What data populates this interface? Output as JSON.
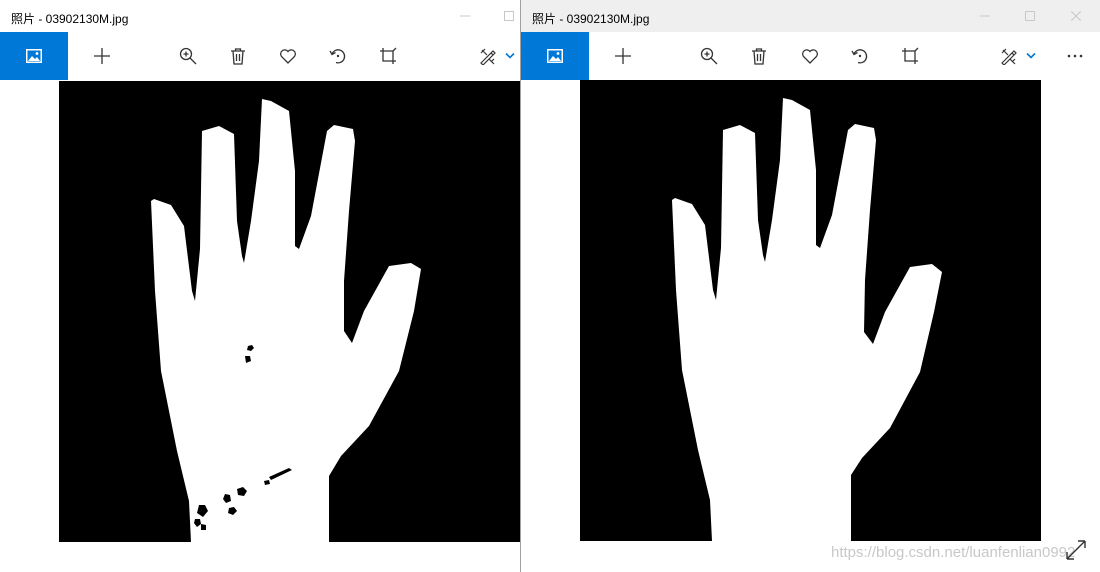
{
  "windows": {
    "left": {
      "title": "照片 - 03902130M.jpg"
    },
    "right": {
      "title": "照片 - 03902130M.jpg"
    }
  },
  "toolbar": {
    "tools": [
      "collection-icon",
      "add-icon",
      "zoom-in-icon",
      "delete-icon",
      "favorite-icon",
      "rotate-icon",
      "crop-icon",
      "edit-icon",
      "chevron-down-icon",
      "more-icon"
    ]
  },
  "colors": {
    "accent": "#0078d7",
    "image_background": "#000000",
    "hand": "#ffffff"
  },
  "watermark": "https://blog.csdn.net/luanfenlian0992"
}
